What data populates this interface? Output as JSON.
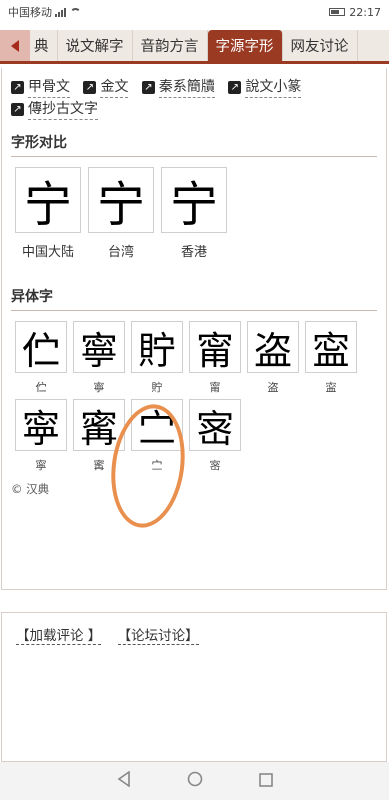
{
  "status": {
    "carrier": "中国移动",
    "time": "22:17"
  },
  "tabs": [
    {
      "label": "典"
    },
    {
      "label": "说文解字"
    },
    {
      "label": "音韵方言"
    },
    {
      "label": "字源字形"
    },
    {
      "label": "网友讨论"
    }
  ],
  "links": [
    {
      "label": "甲骨文"
    },
    {
      "label": "金文"
    },
    {
      "label": "秦系簡牘"
    },
    {
      "label": "說文小篆"
    },
    {
      "label": "傳抄古文字"
    }
  ],
  "glyph_compare": {
    "title": "字形对比",
    "items": [
      {
        "char": "宁",
        "caption": "中国大陆"
      },
      {
        "char": "宁",
        "caption": "台湾"
      },
      {
        "char": "宁",
        "caption": "香港"
      }
    ]
  },
  "variants": {
    "title": "异体字",
    "items": [
      {
        "char": "伫",
        "caption": "伫"
      },
      {
        "char": "寧",
        "caption": "寧"
      },
      {
        "char": "貯",
        "caption": "貯"
      },
      {
        "char": "甯",
        "caption": "甯"
      },
      {
        "char": "盗",
        "caption": "盗"
      },
      {
        "char": "寍",
        "caption": "寍"
      },
      {
        "char": "寜",
        "caption": "寜"
      },
      {
        "char": "寗",
        "caption": "寗"
      },
      {
        "char": "㝉",
        "caption": "㝉"
      },
      {
        "char": "宻",
        "caption": "宻"
      }
    ]
  },
  "copyright": "© 汉典",
  "comments": {
    "load_label": "【加载评论 】",
    "forum_label": "【论坛讨论】"
  },
  "colors": {
    "accent": "#9b3a22",
    "annotation": "#e9904f"
  }
}
